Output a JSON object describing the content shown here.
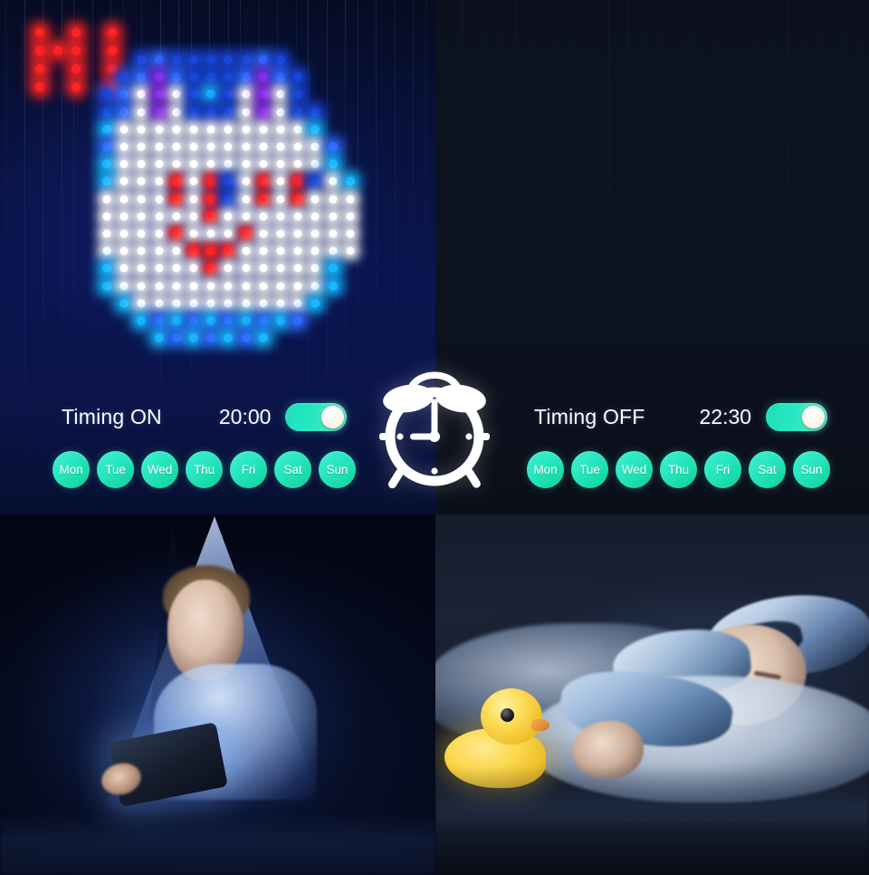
{
  "product_banner": {
    "title_context": "Smart LED curtain light timing feature"
  },
  "led_display": {
    "text_pattern": "HI",
    "text_color": "#ff2b2b",
    "face_colors": [
      "#2f6bff",
      "#7a2fe0",
      "#ffffff",
      "#12b6ff",
      "#ff2b2b"
    ],
    "background_color": "#0a1550"
  },
  "dark_panel": {
    "background_color": "#0d1320"
  },
  "alarm_icon": {
    "name": "alarm-clock-icon",
    "color": "#ffffff",
    "hour_hand": "9",
    "minute_hand": "12"
  },
  "timing_on": {
    "label": "Timing ON",
    "time": "20:00",
    "enabled": true,
    "toggle_state": "on",
    "accent_color": "#2ae8c2",
    "days": [
      {
        "short": "Mon",
        "selected": true
      },
      {
        "short": "Tue",
        "selected": true
      },
      {
        "short": "Wed",
        "selected": true
      },
      {
        "short": "Thu",
        "selected": true
      },
      {
        "short": "Fri",
        "selected": true
      },
      {
        "short": "Sat",
        "selected": true
      },
      {
        "short": "Sun",
        "selected": true
      }
    ]
  },
  "timing_off": {
    "label": "Timing OFF",
    "time": "22:30",
    "enabled": true,
    "toggle_state": "on",
    "accent_color": "#2ae8c2",
    "days": [
      {
        "short": "Mon",
        "selected": true
      },
      {
        "short": "Tue",
        "selected": true
      },
      {
        "short": "Wed",
        "selected": true
      },
      {
        "short": "Thu",
        "selected": true
      },
      {
        "short": "Fri",
        "selected": true
      },
      {
        "short": "Sat",
        "selected": true
      },
      {
        "short": "Sun",
        "selected": true
      }
    ]
  },
  "photo_left": {
    "name": "child-with-tablet-under-blanket-photo"
  },
  "photo_right": {
    "name": "sleeping-baby-with-duck-nightlight-photo"
  }
}
